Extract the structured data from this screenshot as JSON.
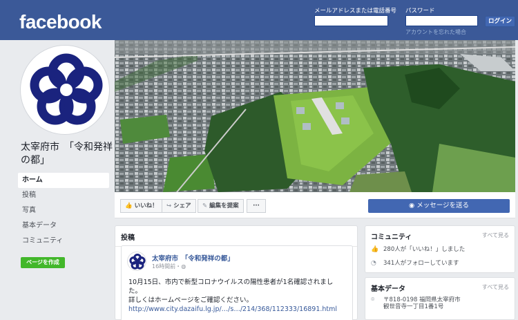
{
  "header": {
    "logo": "facebook",
    "email_label": "メールアドレスまたは電話番号",
    "password_label": "パスワード",
    "login_button": "ログイン",
    "forgot_link": "アカウントを忘れた場合"
  },
  "page": {
    "name": "太宰府市　「令和発祥の都」",
    "create_page_button": "ページを作成"
  },
  "left_nav": {
    "items": [
      {
        "label": "ホーム"
      },
      {
        "label": "投稿"
      },
      {
        "label": "写真"
      },
      {
        "label": "基本データ"
      },
      {
        "label": "コミュニティ"
      }
    ]
  },
  "actions": {
    "like": "いいね！",
    "share": "シェア",
    "suggest": "編集を提案",
    "more": "···",
    "message": "メッセージを送る"
  },
  "posts": {
    "title": "投稿",
    "post": {
      "author": "太宰府市　「令和発祥の都」",
      "time": "16時間前・",
      "line1": "10月15日、市内で新型コロナウイルスの陽性患者が1名確認されまし",
      "line2": "た。",
      "line3": "詳しくはホームページをご確認ください。",
      "link": "http://www.city.dazaifu.lg.jp/…/s…/214/368/112333/16891.html"
    }
  },
  "community": {
    "title": "コミュニティ",
    "more": "すべて見る",
    "likes": "280人が「いいね！」しました",
    "follows": "341人がフォローしています"
  },
  "about": {
    "title": "基本データ",
    "more": "すべて見る",
    "address_line1": "〒818-0198 福岡県太宰府市",
    "address_line2": "観世音寺一丁目1番1号"
  },
  "colors": {
    "brand": "#3b5998",
    "button_blue": "#4267b2",
    "create_green": "#42b72a",
    "emblem_navy": "#1a237e"
  }
}
